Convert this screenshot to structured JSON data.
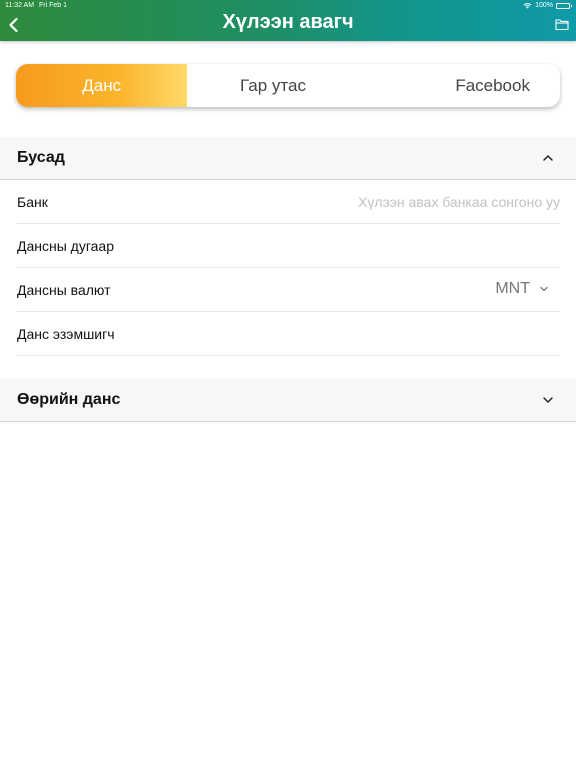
{
  "status_bar": {
    "time": "11:32 AM",
    "date": "Fri Feb 1",
    "battery": "100%"
  },
  "header": {
    "title": "Хүлээн авагч",
    "back_icon": "chevron-left-icon",
    "action_icon": "folder-icon"
  },
  "tabs": [
    {
      "label": "Данс",
      "active": true
    },
    {
      "label": "Гар утас",
      "active": false
    },
    {
      "label": "Facebook",
      "active": false
    }
  ],
  "sections": {
    "other": {
      "title": "Бусад",
      "expanded": true,
      "fields": {
        "bank": {
          "label": "Банк",
          "placeholder": "Хүлээн авах банкаа сонгоно уу"
        },
        "account_number": {
          "label": "Дансны дугаар",
          "value": ""
        },
        "currency": {
          "label": "Дансны валют",
          "value": "MNT"
        },
        "account_holder": {
          "label": "Данс эзэмшигч",
          "value": ""
        }
      }
    },
    "own_account": {
      "title": "Өөрийн данс",
      "expanded": false
    }
  },
  "colors": {
    "header_start": "#2e8b3c",
    "header_end": "#0f9aa8",
    "tab_active_start": "#f79a1e",
    "tab_active_end": "#ffd968"
  }
}
